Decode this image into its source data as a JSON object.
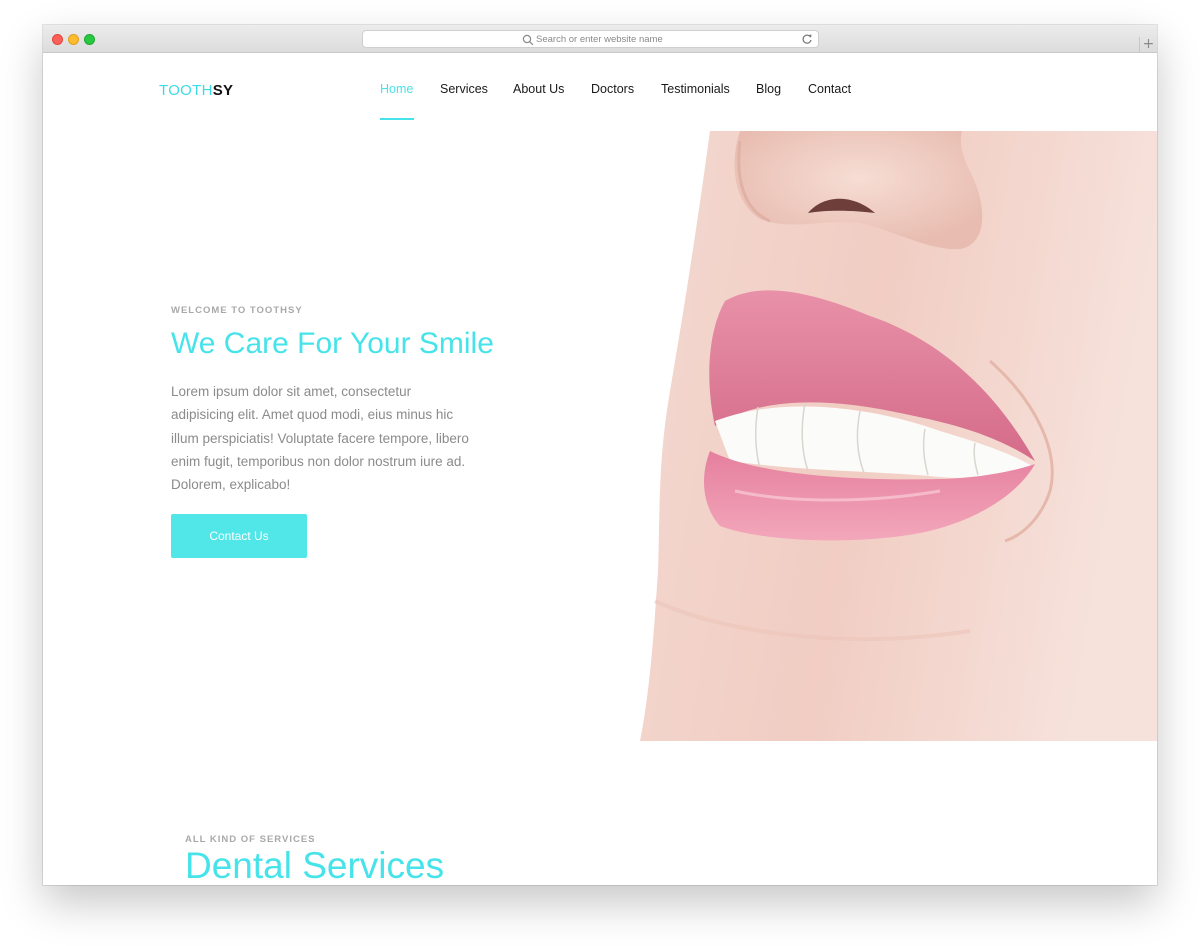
{
  "browser": {
    "url_placeholder": "Search or enter website name",
    "new_tab_symbol": "+"
  },
  "brand": {
    "logo_part1": "TOOTH",
    "logo_part2": "SY",
    "accent_color": "#47e3ea"
  },
  "nav": {
    "items": [
      {
        "label": "Home",
        "active": true
      },
      {
        "label": "Services"
      },
      {
        "label": "About Us"
      },
      {
        "label": "Doctors"
      },
      {
        "label": "Testimonials"
      },
      {
        "label": "Blog"
      },
      {
        "label": "Contact"
      }
    ]
  },
  "hero": {
    "eyebrow": "WELCOME TO TOOTHSY",
    "title": "We Care For Your Smile",
    "body_lines": [
      "Lorem ipsum dolor sit amet, consectetur",
      "adipisicing elit. Amet quod modi, eius minus hic",
      "illum perspiciatis! Voluptate facere tempore, libero",
      "enim fugit, temporibus non dolor nostrum iure ad.",
      "Dolorem, explicabo!"
    ],
    "cta_label": "Contact Us"
  },
  "services": {
    "eyebrow": "ALL KIND OF SERVICES",
    "title": "Dental Services"
  }
}
